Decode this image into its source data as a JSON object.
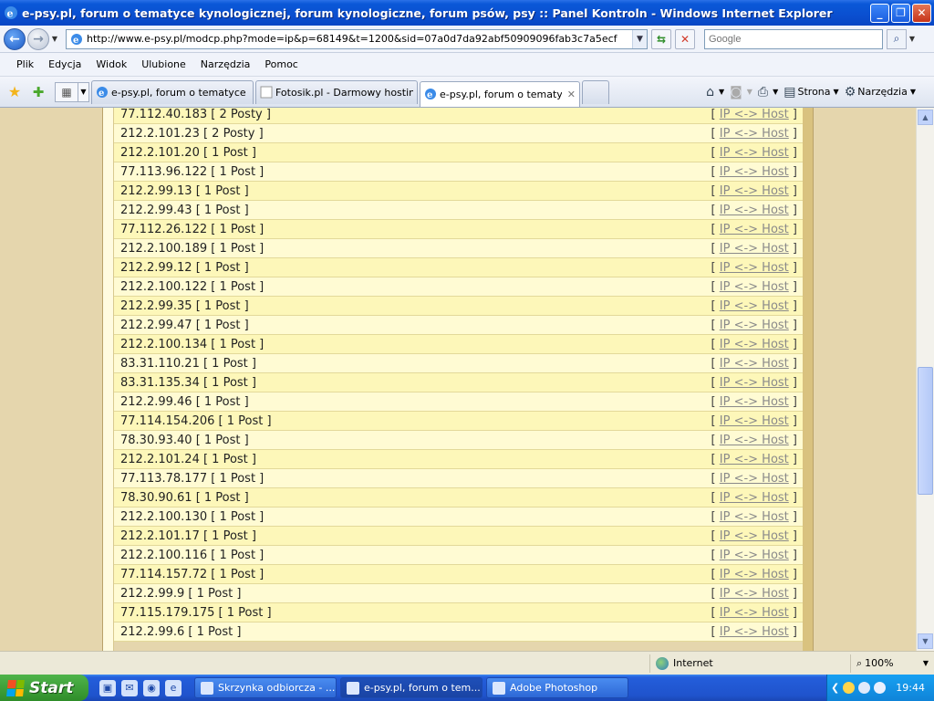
{
  "window": {
    "title": "e-psy.pl, forum o tematyce kynologicznej, forum kynologiczne, forum psów, psy :: Panel Kontroln - Windows Internet Explorer",
    "minimize": "_",
    "maximize": "❐",
    "close": "✕"
  },
  "addressbar": {
    "url": "http://www.e-psy.pl/modcp.php?mode=ip&p=68149&t=1200&sid=07a0d7da92abf50909096fab3c7a5ecf",
    "search_placeholder": "Google"
  },
  "menu": [
    "Plik",
    "Edycja",
    "Widok",
    "Ulubione",
    "Narzędzia",
    "Pomoc"
  ],
  "tabs": [
    {
      "label": "e-psy.pl, forum o tematyce k..."
    },
    {
      "label": "Fotosik.pl - Darmowy hosting..."
    },
    {
      "label": "e-psy.pl, forum o tematy..."
    }
  ],
  "commands": {
    "page": "Strona",
    "tools": "Narzędzia"
  },
  "ip_rows": [
    {
      "ip": "77.112.40.183 [ 2 Posty ]",
      "lookup_open": "[ ",
      "lookup_label": "IP <-> Host",
      "lookup_close": " ]"
    },
    {
      "ip": "212.2.101.23 [ 2 Posty ]",
      "lookup_open": "[ ",
      "lookup_label": "IP <-> Host",
      "lookup_close": " ]"
    },
    {
      "ip": "212.2.101.20 [ 1 Post ]",
      "lookup_open": "[ ",
      "lookup_label": "IP <-> Host",
      "lookup_close": " ]"
    },
    {
      "ip": "77.113.96.122 [ 1 Post ]",
      "lookup_open": "[ ",
      "lookup_label": "IP <-> Host",
      "lookup_close": " ]"
    },
    {
      "ip": "212.2.99.13 [ 1 Post ]",
      "lookup_open": "[ ",
      "lookup_label": "IP <-> Host",
      "lookup_close": " ]"
    },
    {
      "ip": "212.2.99.43 [ 1 Post ]",
      "lookup_open": "[ ",
      "lookup_label": "IP <-> Host",
      "lookup_close": " ]"
    },
    {
      "ip": "77.112.26.122 [ 1 Post ]",
      "lookup_open": "[ ",
      "lookup_label": "IP <-> Host",
      "lookup_close": " ]"
    },
    {
      "ip": "212.2.100.189 [ 1 Post ]",
      "lookup_open": "[ ",
      "lookup_label": "IP <-> Host",
      "lookup_close": " ]"
    },
    {
      "ip": "212.2.99.12 [ 1 Post ]",
      "lookup_open": "[ ",
      "lookup_label": "IP <-> Host",
      "lookup_close": " ]"
    },
    {
      "ip": "212.2.100.122 [ 1 Post ]",
      "lookup_open": "[ ",
      "lookup_label": "IP <-> Host",
      "lookup_close": " ]"
    },
    {
      "ip": "212.2.99.35 [ 1 Post ]",
      "lookup_open": "[ ",
      "lookup_label": "IP <-> Host",
      "lookup_close": " ]"
    },
    {
      "ip": "212.2.99.47 [ 1 Post ]",
      "lookup_open": "[ ",
      "lookup_label": "IP <-> Host",
      "lookup_close": " ]"
    },
    {
      "ip": "212.2.100.134 [ 1 Post ]",
      "lookup_open": "[ ",
      "lookup_label": "IP <-> Host",
      "lookup_close": " ]"
    },
    {
      "ip": "83.31.110.21 [ 1 Post ]",
      "lookup_open": "[ ",
      "lookup_label": "IP <-> Host",
      "lookup_close": " ]"
    },
    {
      "ip": "83.31.135.34 [ 1 Post ]",
      "lookup_open": "[ ",
      "lookup_label": "IP <-> Host",
      "lookup_close": " ]"
    },
    {
      "ip": "212.2.99.46 [ 1 Post ]",
      "lookup_open": "[ ",
      "lookup_label": "IP <-> Host",
      "lookup_close": " ]"
    },
    {
      "ip": "77.114.154.206 [ 1 Post ]",
      "lookup_open": "[ ",
      "lookup_label": "IP <-> Host",
      "lookup_close": " ]"
    },
    {
      "ip": "78.30.93.40 [ 1 Post ]",
      "lookup_open": "[ ",
      "lookup_label": "IP <-> Host",
      "lookup_close": " ]"
    },
    {
      "ip": "212.2.101.24 [ 1 Post ]",
      "lookup_open": "[ ",
      "lookup_label": "IP <-> Host",
      "lookup_close": " ]"
    },
    {
      "ip": "77.113.78.177 [ 1 Post ]",
      "lookup_open": "[ ",
      "lookup_label": "IP <-> Host",
      "lookup_close": " ]"
    },
    {
      "ip": "78.30.90.61 [ 1 Post ]",
      "lookup_open": "[ ",
      "lookup_label": "IP <-> Host",
      "lookup_close": " ]"
    },
    {
      "ip": "212.2.100.130 [ 1 Post ]",
      "lookup_open": "[ ",
      "lookup_label": "IP <-> Host",
      "lookup_close": " ]"
    },
    {
      "ip": "212.2.101.17 [ 1 Post ]",
      "lookup_open": "[ ",
      "lookup_label": "IP <-> Host",
      "lookup_close": " ]"
    },
    {
      "ip": "212.2.100.116 [ 1 Post ]",
      "lookup_open": "[ ",
      "lookup_label": "IP <-> Host",
      "lookup_close": " ]"
    },
    {
      "ip": "77.114.157.72 [ 1 Post ]",
      "lookup_open": "[ ",
      "lookup_label": "IP <-> Host",
      "lookup_close": " ]"
    },
    {
      "ip": "212.2.99.9 [ 1 Post ]",
      "lookup_open": "[ ",
      "lookup_label": "IP <-> Host",
      "lookup_close": " ]"
    },
    {
      "ip": "77.115.179.175 [ 1 Post ]",
      "lookup_open": "[ ",
      "lookup_label": "IP <-> Host",
      "lookup_close": " ]"
    },
    {
      "ip": "212.2.99.6 [ 1 Post ]",
      "lookup_open": "[ ",
      "lookup_label": "IP <-> Host",
      "lookup_close": " ]"
    }
  ],
  "status": {
    "zone": "Internet",
    "zoom": "100%"
  },
  "taskbar": {
    "start": "Start",
    "buttons": [
      {
        "label": "Skrzynka odbiorcza - ..."
      },
      {
        "label": "e-psy.pl, forum o tem..."
      },
      {
        "label": "Adobe Photoshop"
      }
    ],
    "clock": "19:44"
  },
  "colors": {
    "row_odd": "#fdf7b9",
    "row_even": "#fffbd3",
    "page_bg": "#e5d6ad",
    "link": "#8a8a8a"
  }
}
